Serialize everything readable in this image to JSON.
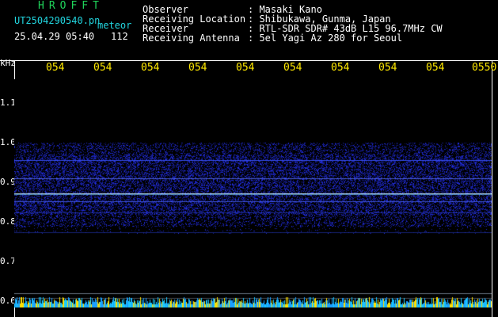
{
  "header": {
    "title_letters": "HROFFT",
    "filename": "UT2504290540.pn",
    "meteor_label": "meteor",
    "datetime": "25.04.29 05:40",
    "count": "112",
    "observer_label": "Observer",
    "observer_value": ": Masaki Kano",
    "location_label": "Receiving Location",
    "location_value": ": Shibukawa, Gunma, Japan",
    "receiver_label": "Receiver",
    "receiver_value": ": RTL-SDR SDR# 43dB L15 96.7MHz CW",
    "antenna_label": "Receiving Antenna",
    "antenna_value": ": 5el Yagi Az 280 for Seoul"
  },
  "axes": {
    "y_unit": "kHz",
    "y_ticks": [
      "1.1",
      "1.0",
      "0.9",
      "0.8",
      "0.7",
      "0.6"
    ],
    "x_ticks": [
      "054",
      "054",
      "054",
      "054",
      "054",
      "054",
      "054",
      "054",
      "054",
      "0550"
    ]
  },
  "colors": {
    "background": "#000000",
    "signal": "#1a2cff",
    "carrier": "#e8f4ff",
    "noise_floor": "#19c8ff"
  }
}
